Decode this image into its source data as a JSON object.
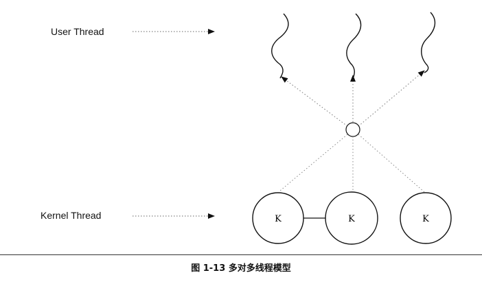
{
  "labels": {
    "user_thread": "User Thread",
    "kernel_thread": "Kernel Thread"
  },
  "kernel_nodes": [
    "K",
    "K",
    "K"
  ],
  "caption": "图 1-13   多对多线程模型"
}
